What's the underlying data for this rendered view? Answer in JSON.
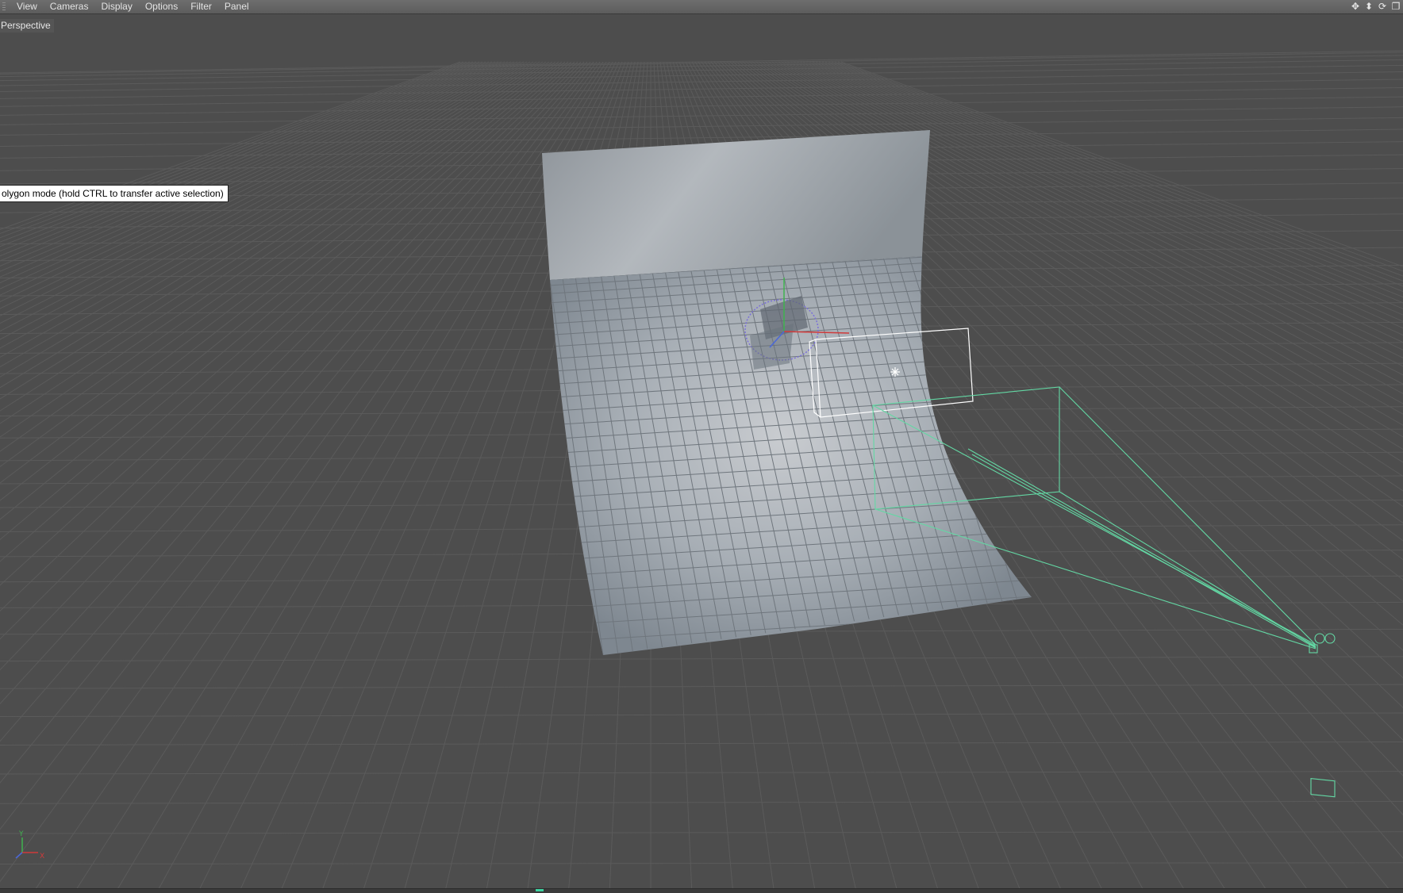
{
  "menubar": {
    "items": [
      {
        "label": "View"
      },
      {
        "label": "Cameras"
      },
      {
        "label": "Display"
      },
      {
        "label": "Options"
      },
      {
        "label": "Filter"
      },
      {
        "label": "Panel"
      }
    ],
    "nav_icons": [
      {
        "name": "move-view-icon",
        "glyph": "✥"
      },
      {
        "name": "zoom-view-icon",
        "glyph": "⬍"
      },
      {
        "name": "rotate-view-icon",
        "glyph": "⟳"
      },
      {
        "name": "toggle-layout-icon",
        "glyph": "❐"
      }
    ]
  },
  "viewport": {
    "label": "Perspective",
    "tooltip": "olygon mode (hold CTRL to transfer active selection)",
    "axis_labels": {
      "y": "Y",
      "x": "X"
    }
  },
  "colors": {
    "background": "#4d4d4d",
    "grid_line": "#5a5a5a",
    "camera_wire": "#63d8a4",
    "axis_x": "#d03a3a",
    "axis_y": "#3fb34f",
    "axis_z": "#4a67d8",
    "selection_box": "#ffffff",
    "timeline_accent": "#3dd2a0"
  }
}
